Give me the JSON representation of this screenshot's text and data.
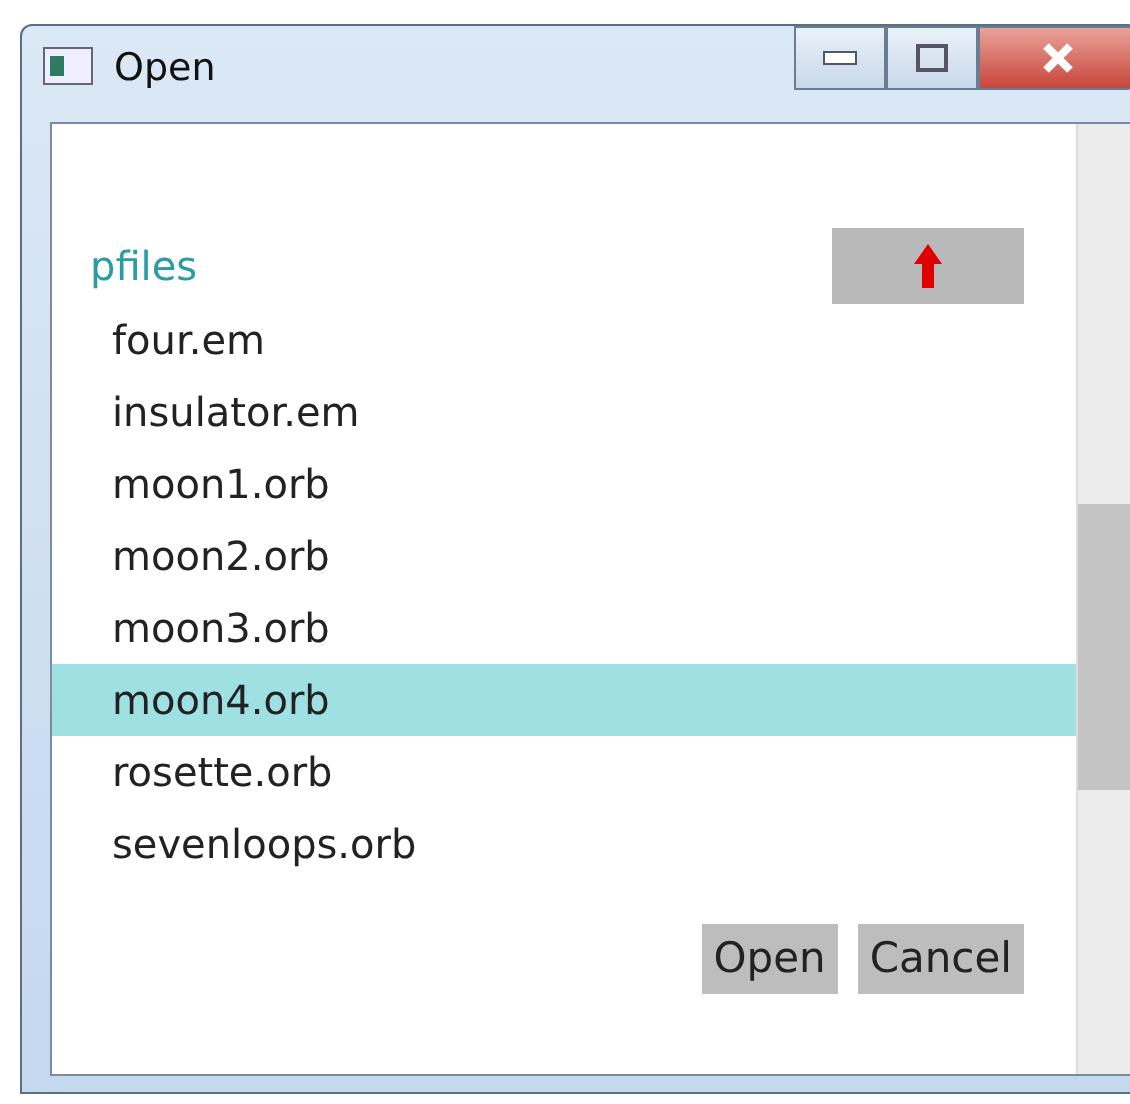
{
  "window": {
    "title": "Open"
  },
  "folder": "pfiles",
  "files": [
    {
      "name": "four.em",
      "selected": false
    },
    {
      "name": "insulator.em",
      "selected": false
    },
    {
      "name": "moon1.orb",
      "selected": false
    },
    {
      "name": "moon2.orb",
      "selected": false
    },
    {
      "name": "moon3.orb",
      "selected": false
    },
    {
      "name": "moon4.orb",
      "selected": true
    },
    {
      "name": "rosette.orb",
      "selected": false
    },
    {
      "name": "sevenloops.orb",
      "selected": false
    }
  ],
  "buttons": [
    "Open",
    "Cancel"
  ]
}
